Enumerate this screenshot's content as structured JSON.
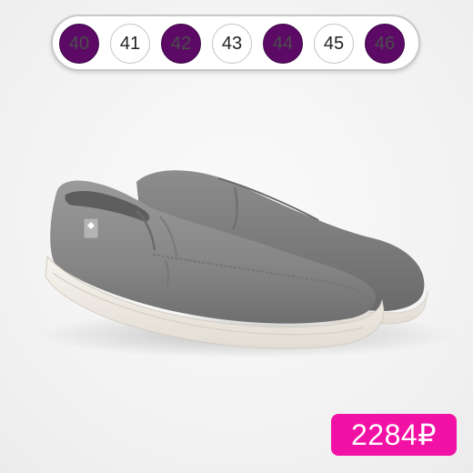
{
  "sizes": [
    {
      "label": "40",
      "available": true
    },
    {
      "label": "41",
      "available": false
    },
    {
      "label": "42",
      "available": true
    },
    {
      "label": "43",
      "available": false
    },
    {
      "label": "44",
      "available": true
    },
    {
      "label": "45",
      "available": false
    },
    {
      "label": "46",
      "available": true
    }
  ],
  "product": {
    "image_icon": "grey-canvas-slip-on-shoes",
    "price": "2284₽"
  },
  "colors": {
    "available_chip": "#5c0a66",
    "price_tag": "#f211a5",
    "shoe_body": "#8a8a8a",
    "sole": "#f1eee8"
  }
}
